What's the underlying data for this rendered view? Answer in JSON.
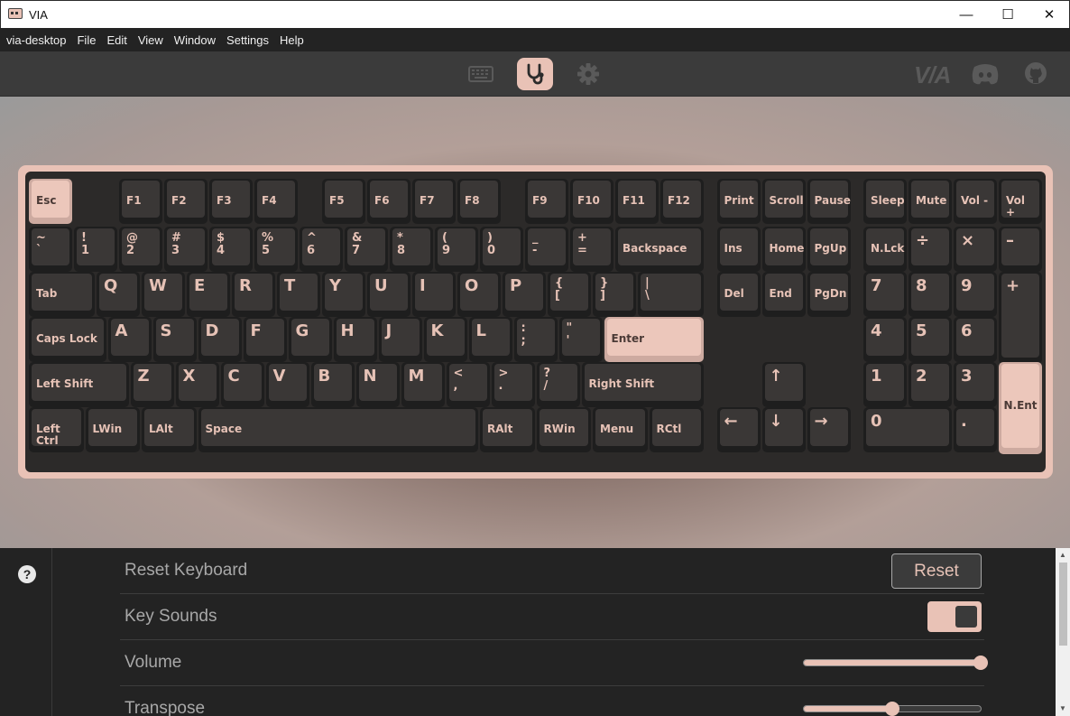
{
  "window": {
    "title": "VIA",
    "minimize": "—",
    "maximize": "☐",
    "close": "✕"
  },
  "menu": [
    "via-desktop",
    "File",
    "Edit",
    "View",
    "Window",
    "Settings",
    "Help"
  ],
  "nav": {
    "brand": "V/A"
  },
  "colors": {
    "accent": "#e9c2b6",
    "keycap": "#3a3736",
    "legend": "#e6c2b6",
    "panel": "#232323"
  },
  "keys": [
    {
      "l": "Esc",
      "x": 0,
      "y": 0,
      "w": 1,
      "h": 1,
      "accent": true
    },
    {
      "l": "F1",
      "x": 2,
      "y": 0,
      "w": 1,
      "h": 1
    },
    {
      "l": "F2",
      "x": 3,
      "y": 0,
      "w": 1,
      "h": 1
    },
    {
      "l": "F3",
      "x": 4,
      "y": 0,
      "w": 1,
      "h": 1
    },
    {
      "l": "F4",
      "x": 5,
      "y": 0,
      "w": 1,
      "h": 1
    },
    {
      "l": "F5",
      "x": 6.5,
      "y": 0,
      "w": 1,
      "h": 1
    },
    {
      "l": "F6",
      "x": 7.5,
      "y": 0,
      "w": 1,
      "h": 1
    },
    {
      "l": "F7",
      "x": 8.5,
      "y": 0,
      "w": 1,
      "h": 1
    },
    {
      "l": "F8",
      "x": 9.5,
      "y": 0,
      "w": 1,
      "h": 1
    },
    {
      "l": "F9",
      "x": 11,
      "y": 0,
      "w": 1,
      "h": 1
    },
    {
      "l": "F10",
      "x": 12,
      "y": 0,
      "w": 1,
      "h": 1
    },
    {
      "l": "F11",
      "x": 13,
      "y": 0,
      "w": 1,
      "h": 1
    },
    {
      "l": "F12",
      "x": 14,
      "y": 0,
      "w": 1,
      "h": 1
    },
    {
      "l": "Print",
      "x": 15.25,
      "y": 0,
      "w": 1,
      "h": 1
    },
    {
      "l": "Scroll",
      "x": 16.25,
      "y": 0,
      "w": 1,
      "h": 1
    },
    {
      "l": "Pause",
      "x": 17.25,
      "y": 0,
      "w": 1,
      "h": 1
    },
    {
      "l": "Sleep",
      "x": 18.5,
      "y": 0,
      "w": 1,
      "h": 1
    },
    {
      "l": "Mute",
      "x": 19.5,
      "y": 0,
      "w": 1,
      "h": 1
    },
    {
      "l": "Vol -",
      "x": 20.5,
      "y": 0,
      "w": 1,
      "h": 1
    },
    {
      "l": "Vol +",
      "x": 21.5,
      "y": 0,
      "w": 1,
      "h": 1
    },
    {
      "t": "~",
      "b": "`",
      "x": 0,
      "y": 1.25,
      "w": 1,
      "h": 1
    },
    {
      "t": "!",
      "b": "1",
      "x": 1,
      "y": 1.25,
      "w": 1,
      "h": 1
    },
    {
      "t": "@",
      "b": "2",
      "x": 2,
      "y": 1.25,
      "w": 1,
      "h": 1
    },
    {
      "t": "#",
      "b": "3",
      "x": 3,
      "y": 1.25,
      "w": 1,
      "h": 1
    },
    {
      "t": "$",
      "b": "4",
      "x": 4,
      "y": 1.25,
      "w": 1,
      "h": 1
    },
    {
      "t": "%",
      "b": "5",
      "x": 5,
      "y": 1.25,
      "w": 1,
      "h": 1
    },
    {
      "t": "^",
      "b": "6",
      "x": 6,
      "y": 1.25,
      "w": 1,
      "h": 1
    },
    {
      "t": "&",
      "b": "7",
      "x": 7,
      "y": 1.25,
      "w": 1,
      "h": 1
    },
    {
      "t": "*",
      "b": "8",
      "x": 8,
      "y": 1.25,
      "w": 1,
      "h": 1
    },
    {
      "t": "(",
      "b": "9",
      "x": 9,
      "y": 1.25,
      "w": 1,
      "h": 1
    },
    {
      "t": ")",
      "b": "0",
      "x": 10,
      "y": 1.25,
      "w": 1,
      "h": 1
    },
    {
      "t": "_",
      "b": "-",
      "x": 11,
      "y": 1.25,
      "w": 1,
      "h": 1
    },
    {
      "t": "+",
      "b": "=",
      "x": 12,
      "y": 1.25,
      "w": 1,
      "h": 1
    },
    {
      "l": "Backspace",
      "x": 13,
      "y": 1.25,
      "w": 2,
      "h": 1
    },
    {
      "l": "Ins",
      "x": 15.25,
      "y": 1.25,
      "w": 1,
      "h": 1
    },
    {
      "l": "Home",
      "x": 16.25,
      "y": 1.25,
      "w": 1,
      "h": 1
    },
    {
      "l": "PgUp",
      "x": 17.25,
      "y": 1.25,
      "w": 1,
      "h": 1
    },
    {
      "l": "N.Lck",
      "x": 18.5,
      "y": 1.25,
      "w": 1,
      "h": 1
    },
    {
      "big": "÷",
      "x": 19.5,
      "y": 1.25,
      "w": 1,
      "h": 1
    },
    {
      "big": "×",
      "x": 20.5,
      "y": 1.25,
      "w": 1,
      "h": 1
    },
    {
      "big": "–",
      "x": 21.5,
      "y": 1.25,
      "w": 1,
      "h": 1
    },
    {
      "l": "Tab",
      "x": 0,
      "y": 2.25,
      "w": 1.5,
      "h": 1
    },
    {
      "big": "Q",
      "x": 1.5,
      "y": 2.25,
      "w": 1,
      "h": 1
    },
    {
      "big": "W",
      "x": 2.5,
      "y": 2.25,
      "w": 1,
      "h": 1
    },
    {
      "big": "E",
      "x": 3.5,
      "y": 2.25,
      "w": 1,
      "h": 1
    },
    {
      "big": "R",
      "x": 4.5,
      "y": 2.25,
      "w": 1,
      "h": 1
    },
    {
      "big": "T",
      "x": 5.5,
      "y": 2.25,
      "w": 1,
      "h": 1
    },
    {
      "big": "Y",
      "x": 6.5,
      "y": 2.25,
      "w": 1,
      "h": 1
    },
    {
      "big": "U",
      "x": 7.5,
      "y": 2.25,
      "w": 1,
      "h": 1
    },
    {
      "big": "I",
      "x": 8.5,
      "y": 2.25,
      "w": 1,
      "h": 1
    },
    {
      "big": "O",
      "x": 9.5,
      "y": 2.25,
      "w": 1,
      "h": 1
    },
    {
      "big": "P",
      "x": 10.5,
      "y": 2.25,
      "w": 1,
      "h": 1
    },
    {
      "t": "{",
      "b": "[",
      "x": 11.5,
      "y": 2.25,
      "w": 1,
      "h": 1
    },
    {
      "t": "}",
      "b": "]",
      "x": 12.5,
      "y": 2.25,
      "w": 1,
      "h": 1
    },
    {
      "t": "|",
      "b": "\\",
      "x": 13.5,
      "y": 2.25,
      "w": 1.5,
      "h": 1
    },
    {
      "l": "Del",
      "x": 15.25,
      "y": 2.25,
      "w": 1,
      "h": 1
    },
    {
      "l": "End",
      "x": 16.25,
      "y": 2.25,
      "w": 1,
      "h": 1
    },
    {
      "l": "PgDn",
      "x": 17.25,
      "y": 2.25,
      "w": 1,
      "h": 1
    },
    {
      "big": "7",
      "x": 18.5,
      "y": 2.25,
      "w": 1,
      "h": 1
    },
    {
      "big": "8",
      "x": 19.5,
      "y": 2.25,
      "w": 1,
      "h": 1
    },
    {
      "big": "9",
      "x": 20.5,
      "y": 2.25,
      "w": 1,
      "h": 1
    },
    {
      "big": "+",
      "x": 21.5,
      "y": 2.25,
      "w": 1,
      "h": 2
    },
    {
      "l": "Caps Lock",
      "x": 0,
      "y": 3.25,
      "w": 1.75,
      "h": 1
    },
    {
      "big": "A",
      "x": 1.75,
      "y": 3.25,
      "w": 1,
      "h": 1
    },
    {
      "big": "S",
      "x": 2.75,
      "y": 3.25,
      "w": 1,
      "h": 1
    },
    {
      "big": "D",
      "x": 3.75,
      "y": 3.25,
      "w": 1,
      "h": 1
    },
    {
      "big": "F",
      "x": 4.75,
      "y": 3.25,
      "w": 1,
      "h": 1
    },
    {
      "big": "G",
      "x": 5.75,
      "y": 3.25,
      "w": 1,
      "h": 1
    },
    {
      "big": "H",
      "x": 6.75,
      "y": 3.25,
      "w": 1,
      "h": 1
    },
    {
      "big": "J",
      "x": 7.75,
      "y": 3.25,
      "w": 1,
      "h": 1
    },
    {
      "big": "K",
      "x": 8.75,
      "y": 3.25,
      "w": 1,
      "h": 1
    },
    {
      "big": "L",
      "x": 9.75,
      "y": 3.25,
      "w": 1,
      "h": 1
    },
    {
      "t": ":",
      "b": ";",
      "x": 10.75,
      "y": 3.25,
      "w": 1,
      "h": 1
    },
    {
      "t": "\"",
      "b": "'",
      "x": 11.75,
      "y": 3.25,
      "w": 1,
      "h": 1
    },
    {
      "l": "Enter",
      "x": 12.75,
      "y": 3.25,
      "w": 2.25,
      "h": 1,
      "accent": true
    },
    {
      "big": "4",
      "x": 18.5,
      "y": 3.25,
      "w": 1,
      "h": 1
    },
    {
      "big": "5",
      "x": 19.5,
      "y": 3.25,
      "w": 1,
      "h": 1
    },
    {
      "big": "6",
      "x": 20.5,
      "y": 3.25,
      "w": 1,
      "h": 1
    },
    {
      "l": "Left Shift",
      "x": 0,
      "y": 4.25,
      "w": 2.25,
      "h": 1
    },
    {
      "big": "Z",
      "x": 2.25,
      "y": 4.25,
      "w": 1,
      "h": 1
    },
    {
      "big": "X",
      "x": 3.25,
      "y": 4.25,
      "w": 1,
      "h": 1
    },
    {
      "big": "C",
      "x": 4.25,
      "y": 4.25,
      "w": 1,
      "h": 1
    },
    {
      "big": "V",
      "x": 5.25,
      "y": 4.25,
      "w": 1,
      "h": 1
    },
    {
      "big": "B",
      "x": 6.25,
      "y": 4.25,
      "w": 1,
      "h": 1
    },
    {
      "big": "N",
      "x": 7.25,
      "y": 4.25,
      "w": 1,
      "h": 1
    },
    {
      "big": "M",
      "x": 8.25,
      "y": 4.25,
      "w": 1,
      "h": 1
    },
    {
      "t": "<",
      "b": ",",
      "x": 9.25,
      "y": 4.25,
      "w": 1,
      "h": 1
    },
    {
      "t": ">",
      "b": ".",
      "x": 10.25,
      "y": 4.25,
      "w": 1,
      "h": 1
    },
    {
      "t": "?",
      "b": "/",
      "x": 11.25,
      "y": 4.25,
      "w": 1,
      "h": 1
    },
    {
      "l": "Right Shift",
      "x": 12.25,
      "y": 4.25,
      "w": 2.75,
      "h": 1
    },
    {
      "big": "↑",
      "x": 16.25,
      "y": 4.25,
      "w": 1,
      "h": 1
    },
    {
      "big": "1",
      "x": 18.5,
      "y": 4.25,
      "w": 1,
      "h": 1
    },
    {
      "big": "2",
      "x": 19.5,
      "y": 4.25,
      "w": 1,
      "h": 1
    },
    {
      "big": "3",
      "x": 20.5,
      "y": 4.25,
      "w": 1,
      "h": 1
    },
    {
      "l": "N.Ent",
      "x": 21.5,
      "y": 4.25,
      "w": 1,
      "h": 2,
      "accent": true,
      "center": true
    },
    {
      "l": "Left Ctrl",
      "x": 0,
      "y": 5.25,
      "w": 1.25,
      "h": 1
    },
    {
      "l": "LWin",
      "x": 1.25,
      "y": 5.25,
      "w": 1.25,
      "h": 1
    },
    {
      "l": "LAlt",
      "x": 2.5,
      "y": 5.25,
      "w": 1.25,
      "h": 1
    },
    {
      "l": "Space",
      "x": 3.75,
      "y": 5.25,
      "w": 6.25,
      "h": 1
    },
    {
      "l": "RAlt",
      "x": 10,
      "y": 5.25,
      "w": 1.25,
      "h": 1
    },
    {
      "l": "RWin",
      "x": 11.25,
      "y": 5.25,
      "w": 1.25,
      "h": 1
    },
    {
      "l": "Menu",
      "x": 12.5,
      "y": 5.25,
      "w": 1.25,
      "h": 1
    },
    {
      "l": "RCtl",
      "x": 13.75,
      "y": 5.25,
      "w": 1.25,
      "h": 1
    },
    {
      "big": "←",
      "x": 15.25,
      "y": 5.25,
      "w": 1,
      "h": 1
    },
    {
      "big": "↓",
      "x": 16.25,
      "y": 5.25,
      "w": 1,
      "h": 1
    },
    {
      "big": "→",
      "x": 17.25,
      "y": 5.25,
      "w": 1,
      "h": 1
    },
    {
      "big": "0",
      "x": 18.5,
      "y": 5.25,
      "w": 2,
      "h": 1
    },
    {
      "big": ".",
      "x": 20.5,
      "y": 5.25,
      "w": 1,
      "h": 1
    }
  ],
  "settings": {
    "reset_label": "Reset Keyboard",
    "reset_button": "Reset",
    "key_sounds_label": "Key Sounds",
    "key_sounds_on": true,
    "volume_label": "Volume",
    "volume_value": 1.0,
    "transpose_label": "Transpose",
    "transpose_value": 0.5
  }
}
